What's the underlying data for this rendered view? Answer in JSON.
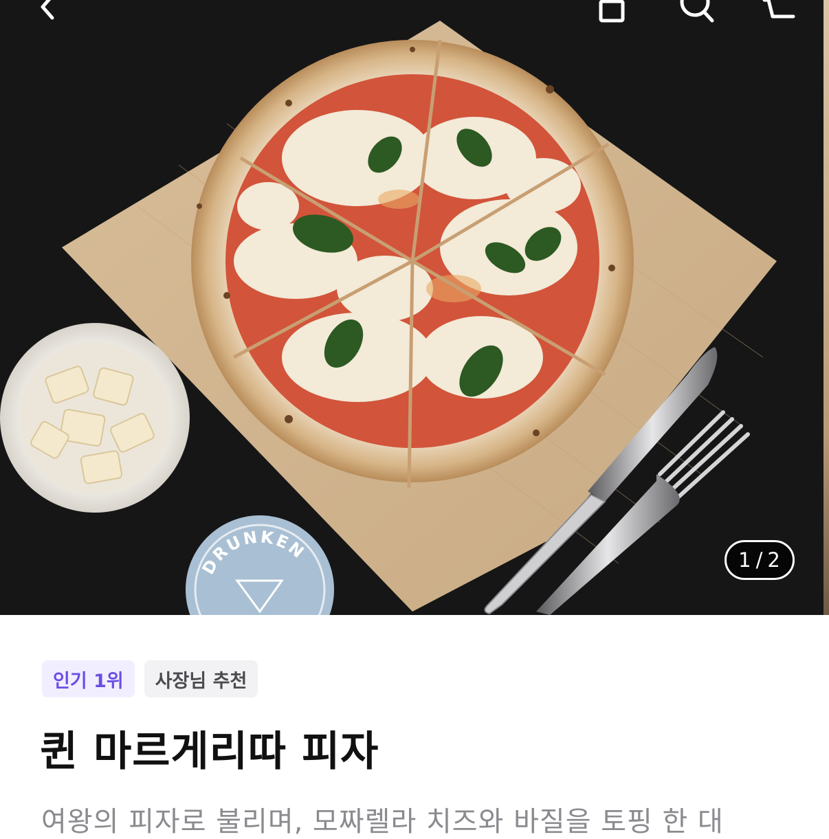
{
  "hero": {
    "coaster_text": "DRUNKEN",
    "page_indicator": {
      "current": "1",
      "separator": "/",
      "total": "2"
    }
  },
  "top_bar": {
    "back_icon": "chevron-left-icon",
    "share_icon": "share-icon",
    "search_icon": "search-icon",
    "cart_icon": "cart-icon"
  },
  "product": {
    "badges": [
      "인기 1위",
      "사장님 추천"
    ],
    "title": "퀸 마르게리따 피자",
    "description": "여왕의 피자로 불리며, 모짜렐라 치즈와 바질을 토핑 한 대"
  },
  "colors": {
    "accent": "#6c4de6",
    "accent_bg": "#f1efff",
    "muted_text": "#8a8a8f",
    "title_text": "#111111"
  }
}
